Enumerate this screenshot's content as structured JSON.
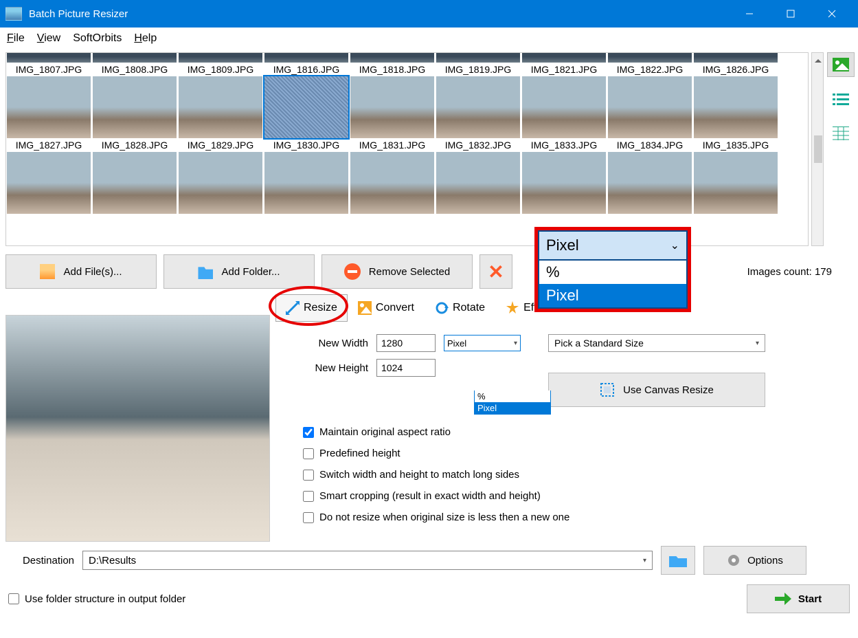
{
  "titlebar": {
    "title": "Batch Picture Resizer"
  },
  "menu": {
    "file": "File",
    "view": "View",
    "softorbits": "SoftOrbits",
    "help": "Help"
  },
  "thumbs": {
    "row1": [
      "IMG_1807.JPG",
      "IMG_1808.JPG",
      "IMG_1809.JPG",
      "IMG_1816.JPG",
      "IMG_1818.JPG",
      "IMG_1819.JPG",
      "IMG_1821.JPG",
      "IMG_1822.JPG",
      "IMG_1826.JPG"
    ],
    "row2": [
      "IMG_1827.JPG",
      "IMG_1828.JPG",
      "IMG_1829.JPG",
      "IMG_1830.JPG",
      "IMG_1831.JPG",
      "IMG_1832.JPG",
      "IMG_1833.JPG",
      "IMG_1834.JPG",
      "IMG_1835.JPG"
    ],
    "selected_index": 3
  },
  "toolbar": {
    "add_files": "Add File(s)...",
    "add_folder": "Add Folder...",
    "remove_selected": "Remove Selected",
    "count_label": "Images count: 179"
  },
  "tabs": {
    "resize": "Resize",
    "convert": "Convert",
    "rotate": "Rotate",
    "effects": "Effects"
  },
  "form": {
    "new_width_label": "New Width",
    "new_width_value": "1280",
    "new_height_label": "New Height",
    "new_height_value": "1024",
    "unit_selected": "Pixel",
    "unit_options": [
      "%",
      "Pixel"
    ],
    "std_size_placeholder": "Pick a Standard Size",
    "canvas_btn": "Use Canvas Resize",
    "maintain_ratio": "Maintain original aspect ratio",
    "predefined_height": "Predefined height",
    "switch_wh": "Switch width and height to match long sides",
    "smart_crop": "Smart cropping (result in exact width and height)",
    "no_resize_smaller": "Do not resize when original size is less then a new one"
  },
  "overlay": {
    "selected": "Pixel",
    "options": [
      "%",
      "Pixel"
    ]
  },
  "bottom": {
    "destination_label": "Destination",
    "destination_value": "D:\\Results",
    "use_folder_structure": "Use folder structure in output folder",
    "options_btn": "Options",
    "start_btn": "Start"
  }
}
